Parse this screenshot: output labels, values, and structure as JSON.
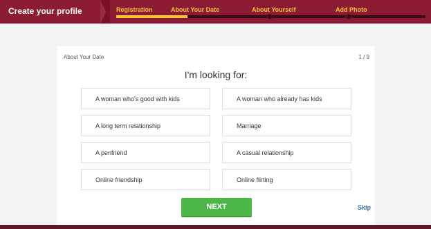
{
  "header": {
    "title": "Create your profile",
    "steps": [
      {
        "label": "Registration"
      },
      {
        "label": "About Your Date"
      },
      {
        "label": "About Yourself"
      },
      {
        "label": "Add Photo"
      }
    ],
    "progress_fraction": 0.23
  },
  "card": {
    "section_label": "About Your Date",
    "step_counter": "1 / 9",
    "question": "I'm looking for:",
    "options": [
      "A woman who's good with kids",
      "A woman who already has kids",
      "A long term relationship",
      "Marriage",
      "A penfriend",
      "A casual relationship",
      "Online friendship",
      "Online flirting"
    ],
    "next_label": "NEXT",
    "skip_label": "Skip"
  },
  "colors": {
    "header_bg": "#8b1c33",
    "step_text": "#f7c331",
    "next_button": "#4cb748",
    "skip_link": "#2e6fb0"
  }
}
